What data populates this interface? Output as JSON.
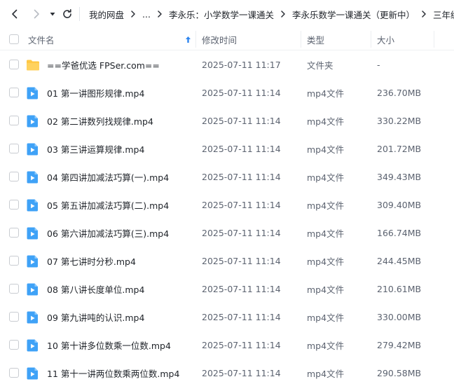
{
  "toolbar": {
    "back_icon": "chevron-left-icon",
    "forward_icon": "chevron-right-icon",
    "dropdown_icon": "caret-down-icon",
    "refresh_icon": "refresh-icon"
  },
  "breadcrumb": {
    "items": [
      "我的网盘",
      "...",
      "李永乐：小学数学一课通关",
      "李永乐数学一课通关（更新中）",
      "三年级"
    ]
  },
  "table": {
    "headers": {
      "name": "文件名",
      "modified": "修改时间",
      "type": "类型",
      "size": "大小"
    },
    "sort_icon": "sort-up-arrow-icon",
    "rows": [
      {
        "icon": "folder-icon",
        "name": "==学爸优选 FPSer.com==",
        "modified": "2025-07-11 11:17",
        "type": "文件夹",
        "size": "-"
      },
      {
        "icon": "video-file-icon",
        "name": "01 第一讲图形规律.mp4",
        "modified": "2025-07-11 11:14",
        "type": "mp4文件",
        "size": "236.70MB"
      },
      {
        "icon": "video-file-icon",
        "name": "02 第二讲数列找规律.mp4",
        "modified": "2025-07-11 11:14",
        "type": "mp4文件",
        "size": "330.22MB"
      },
      {
        "icon": "video-file-icon",
        "name": "03 第三讲运算规律.mp4",
        "modified": "2025-07-11 11:14",
        "type": "mp4文件",
        "size": "201.72MB"
      },
      {
        "icon": "video-file-icon",
        "name": "04 第四讲加减法巧算(一).mp4",
        "modified": "2025-07-11 11:14",
        "type": "mp4文件",
        "size": "349.43MB"
      },
      {
        "icon": "video-file-icon",
        "name": "05 第五讲加减法巧算(二).mp4",
        "modified": "2025-07-11 11:14",
        "type": "mp4文件",
        "size": "309.40MB"
      },
      {
        "icon": "video-file-icon",
        "name": "06 第六讲加减法巧算(三).mp4",
        "modified": "2025-07-11 11:14",
        "type": "mp4文件",
        "size": "166.74MB"
      },
      {
        "icon": "video-file-icon",
        "name": "07 第七讲时分秒.mp4",
        "modified": "2025-07-11 11:14",
        "type": "mp4文件",
        "size": "244.45MB"
      },
      {
        "icon": "video-file-icon",
        "name": "08 第八讲长度单位.mp4",
        "modified": "2025-07-11 11:14",
        "type": "mp4文件",
        "size": "210.61MB"
      },
      {
        "icon": "video-file-icon",
        "name": "09 第九讲吨的认识.mp4",
        "modified": "2025-07-11 11:14",
        "type": "mp4文件",
        "size": "330.00MB"
      },
      {
        "icon": "video-file-icon",
        "name": "10 第十讲多位数乘一位数.mp4",
        "modified": "2025-07-11 11:14",
        "type": "mp4文件",
        "size": "279.42MB"
      },
      {
        "icon": "video-file-icon",
        "name": "11 第十一讲两位数乘两位数.mp4",
        "modified": "2025-07-11 11:14",
        "type": "mp4文件",
        "size": "290.58MB"
      }
    ]
  },
  "colors": {
    "folder": "#ffc845",
    "video": "#3fa2f7",
    "sort_arrow": "#2f86ef"
  }
}
